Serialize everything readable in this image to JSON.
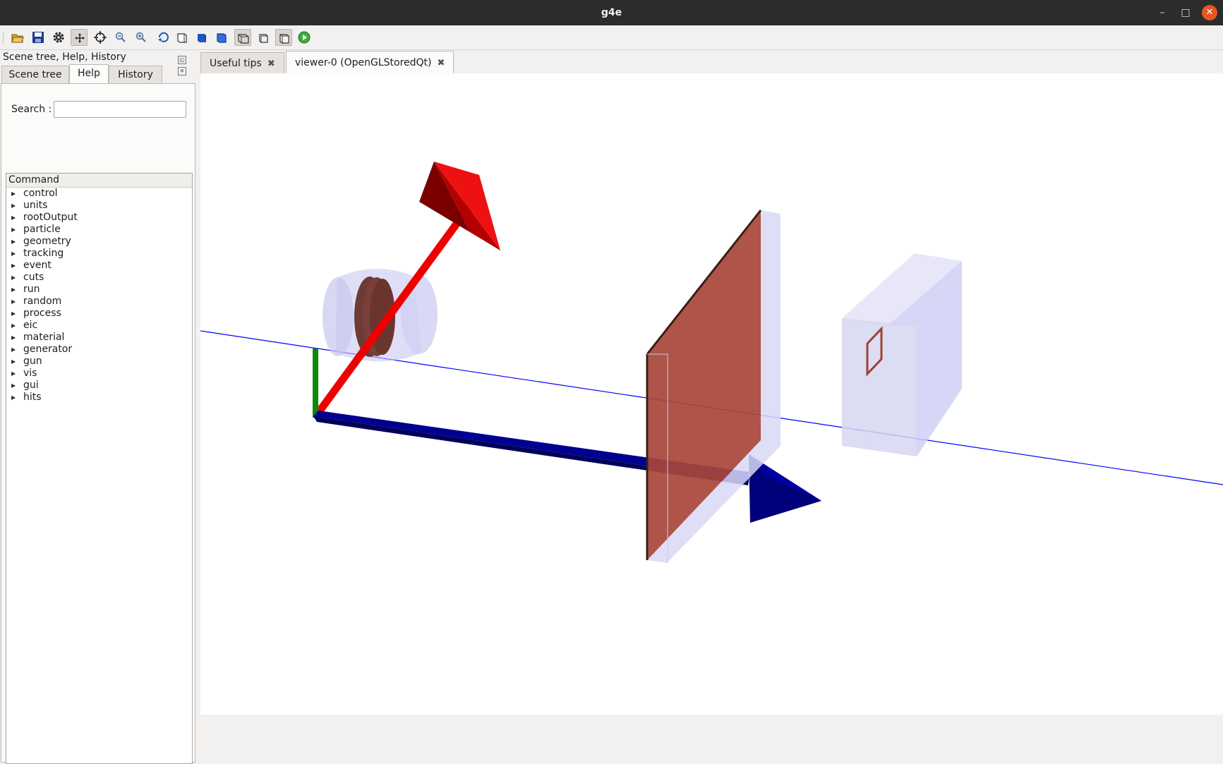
{
  "window": {
    "title": "g4e"
  },
  "window_controls": {
    "minimize": "–",
    "maximize": "□",
    "close": "✕"
  },
  "toolbar": {
    "buttons": [
      {
        "icon": "open-folder-icon"
      },
      {
        "icon": "save-icon"
      },
      {
        "icon": "gear-icon"
      },
      {
        "icon": "move-icon"
      },
      {
        "icon": "pick-target-icon"
      },
      {
        "icon": "zoom-out-icon"
      },
      {
        "icon": "zoom-in-icon"
      },
      {
        "icon": "rotate-icon"
      },
      {
        "icon": "hidden-line-icon"
      },
      {
        "icon": "solid-icon"
      },
      {
        "icon": "surface-icon"
      },
      {
        "icon": "perspective-icon"
      },
      {
        "icon": "ortho-icon"
      },
      {
        "icon": "wireframe-icon"
      },
      {
        "icon": "run-icon"
      }
    ]
  },
  "dock": {
    "title": "Scene tree, Help, History",
    "float_btn": "◱",
    "close_btn": "✕",
    "tabs": [
      "Scene tree",
      "Help",
      "History"
    ],
    "active_tab": "Help",
    "search": {
      "label": "Search :",
      "value": "",
      "placeholder": ""
    },
    "tree": {
      "header": "Command",
      "items": [
        "control",
        "units",
        "rootOutput",
        "particle",
        "geometry",
        "tracking",
        "event",
        "cuts",
        "run",
        "random",
        "process",
        "eic",
        "material",
        "generator",
        "gun",
        "vis",
        "gui",
        "hits"
      ]
    }
  },
  "viewer": {
    "tabs": [
      {
        "label": "Useful tips",
        "close": "✖"
      },
      {
        "label": "viewer-0 (OpenGLStoredQt)",
        "close": "✖"
      }
    ],
    "active_tab": 1
  },
  "colors": {
    "x_axis": "#cc0000",
    "y_axis": "#008800",
    "z_axis": "#000080",
    "volume": "#c8c8f0",
    "detector": "#a0412e",
    "beam_line": "#0000ff"
  }
}
